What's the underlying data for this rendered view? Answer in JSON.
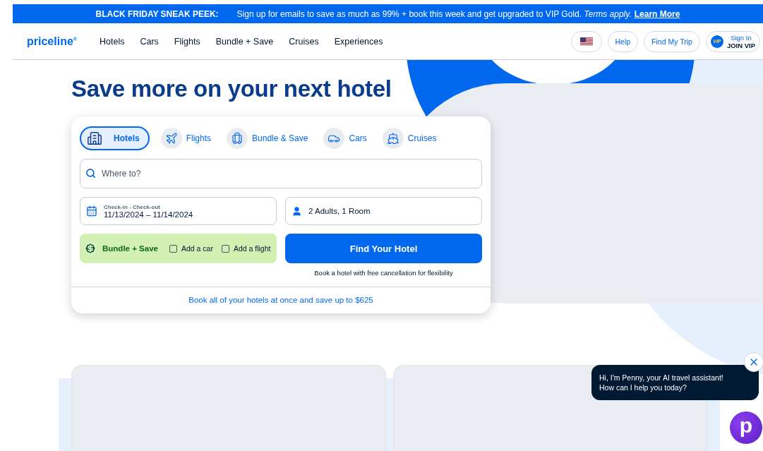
{
  "banner": {
    "label": "BLACK FRIDAY SNEAK PEEK:",
    "text": "Sign up for emails to save as much as 99% + book this week and get upgraded to VIP Gold. *Terms apply.*",
    "link": "Learn More"
  },
  "nav": {
    "logo": "priceline$^{®}$",
    "links": [
      "Hotels",
      "Cars",
      "Flights",
      "Bundle + Save",
      "Cruises",
      "Experiences"
    ],
    "help": "Help",
    "find_trip": "Find My Trip",
    "sign_in": {
      "badge": "VIP",
      "line1": "Sign In",
      "line2": "JOIN VIP"
    }
  },
  "heading": "Save more on your next hotel",
  "search_tabs": [
    {
      "kind": "hotel",
      "label": "Hotels",
      "selected": true
    },
    {
      "kind": "flight",
      "label": "Flights",
      "selected": false
    },
    {
      "kind": "bundle",
      "label": "Bundle & Save",
      "selected": false
    },
    {
      "kind": "car",
      "label": "Cars",
      "selected": false
    },
    {
      "kind": "cruise",
      "label": "Cruises",
      "selected": false
    }
  ],
  "destination": {
    "placeholder": "Where to?"
  },
  "dates": {
    "label": "Check-in - Check-out",
    "value": "11/13/2024 – 11/14/2024"
  },
  "guests": {
    "value": "2 Adults, 1 Room"
  },
  "bundle": {
    "label": "Bundle + Save",
    "options": [
      {
        "label": "Add a car",
        "checked": false
      },
      {
        "label": "Add a flight",
        "checked": false
      }
    ]
  },
  "submit": "Find Your Hotel",
  "note": "Book a hotel with free cancellation for flexibility",
  "footer_link": "Book all of your hotels at once and save up to $625",
  "chat": {
    "message": "Hi, I'm Penny, your AI travel assistant!\nHow can I help you today?",
    "avatar": "p"
  }
}
